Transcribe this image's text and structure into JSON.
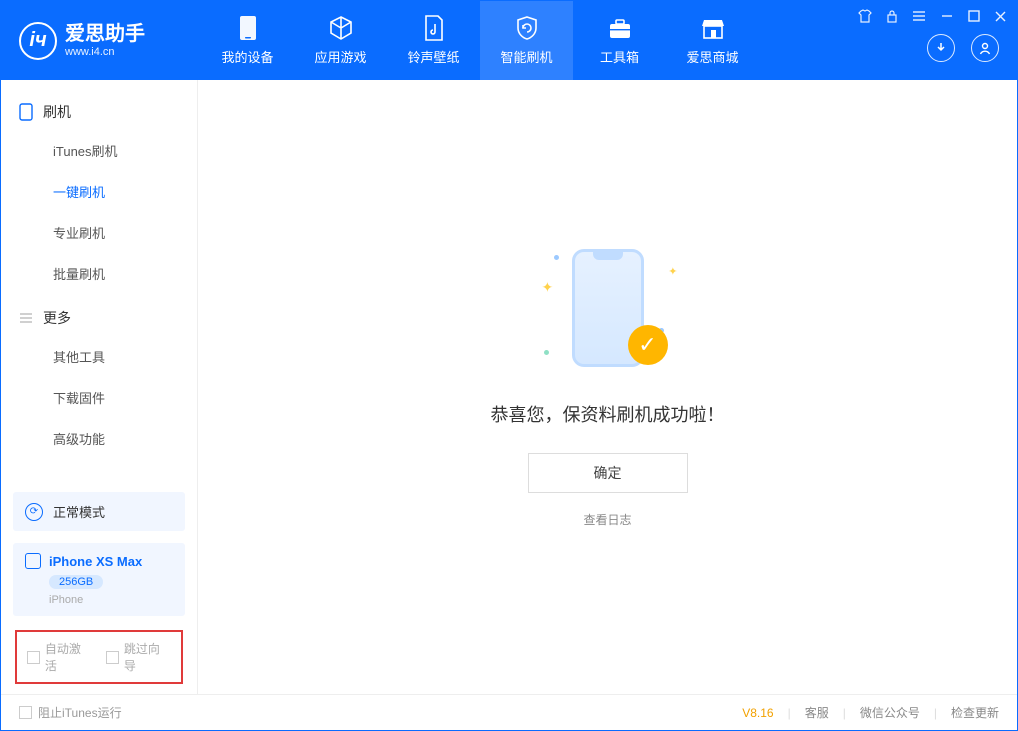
{
  "app": {
    "title": "爱思助手",
    "subtitle": "www.i4.cn"
  },
  "nav": {
    "tabs": [
      {
        "label": "我的设备"
      },
      {
        "label": "应用游戏"
      },
      {
        "label": "铃声壁纸"
      },
      {
        "label": "智能刷机"
      },
      {
        "label": "工具箱"
      },
      {
        "label": "爱思商城"
      }
    ]
  },
  "sidebar": {
    "group1_title": "刷机",
    "group1_items": [
      "iTunes刷机",
      "一键刷机",
      "专业刷机",
      "批量刷机"
    ],
    "group2_title": "更多",
    "group2_items": [
      "其他工具",
      "下载固件",
      "高级功能"
    ],
    "mode_label": "正常模式",
    "device_name": "iPhone XS Max",
    "device_storage": "256GB",
    "device_type": "iPhone",
    "checkbox1": "自动激活",
    "checkbox2": "跳过向导"
  },
  "main": {
    "success_message": "恭喜您，保资料刷机成功啦！",
    "confirm_button": "确定",
    "view_log": "查看日志"
  },
  "status": {
    "block_itunes": "阻止iTunes运行",
    "version": "V8.16",
    "links": [
      "客服",
      "微信公众号",
      "检查更新"
    ]
  }
}
